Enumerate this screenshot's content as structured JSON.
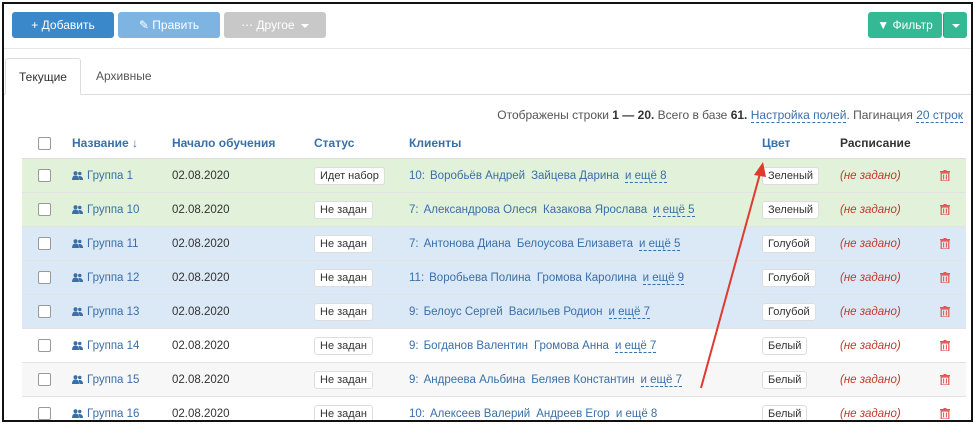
{
  "toolbar": {
    "add_label": "Добавить",
    "edit_label": "Править",
    "other_label": "Другое",
    "filter_label": "Фильтр"
  },
  "tabs": [
    {
      "label": "Текущие",
      "active": true
    },
    {
      "label": "Архивные",
      "active": false
    }
  ],
  "info": {
    "text1": "Отображены строки",
    "range": "1 — 20.",
    "text2": "Всего в базе",
    "total": "61.",
    "settings_link": "Настройка полей",
    "pagination_label": "Пагинация",
    "pagination_value": "20 строк"
  },
  "columns": {
    "name": "Название ↓",
    "start": "Начало обучения",
    "status": "Статус",
    "clients": "Клиенты",
    "color": "Цвет",
    "schedule": "Расписание"
  },
  "rows": [
    {
      "name": "Группа 1",
      "start": "02.08.2020",
      "status": "Идет набор",
      "count": "10:",
      "client1": "Воробьёв Андрей",
      "client2": "Зайцева Дарина",
      "more": "и ещё 8",
      "color": "Зеленый",
      "schedule": "(не задано)",
      "tone": "green"
    },
    {
      "name": "Группа 10",
      "start": "02.08.2020",
      "status": "Не задан",
      "count": "7:",
      "client1": "Александрова Олеся",
      "client2": "Казакова Ярослава",
      "more": "и ещё 5",
      "color": "Зеленый",
      "schedule": "(не задано)",
      "tone": "green"
    },
    {
      "name": "Группа 11",
      "start": "02.08.2020",
      "status": "Не задан",
      "count": "7:",
      "client1": "Антонова Диана",
      "client2": "Белоусова Елизавета",
      "more": "и ещё 5",
      "color": "Голубой",
      "schedule": "(не задано)",
      "tone": "blue"
    },
    {
      "name": "Группа 12",
      "start": "02.08.2020",
      "status": "Не задан",
      "count": "11:",
      "client1": "Воробьева Полина",
      "client2": "Громова Каролина",
      "more": "и ещё 9",
      "color": "Голубой",
      "schedule": "(не задано)",
      "tone": "blue"
    },
    {
      "name": "Группа 13",
      "start": "02.08.2020",
      "status": "Не задан",
      "count": "9:",
      "client1": "Белоус Сергей",
      "client2": "Васильев Родион",
      "more": "и ещё 7",
      "color": "Голубой",
      "schedule": "(не задано)",
      "tone": "blue"
    },
    {
      "name": "Группа 14",
      "start": "02.08.2020",
      "status": "Не задан",
      "count": "9:",
      "client1": "Богданов Валентин",
      "client2": "Громова Анна",
      "more": "и ещё 7",
      "color": "Белый",
      "schedule": "(не задано)",
      "tone": "white"
    },
    {
      "name": "Группа 15",
      "start": "02.08.2020",
      "status": "Не задан",
      "count": "9:",
      "client1": "Андреева Альбина",
      "client2": "Беляев Константин",
      "more": "и ещё 7",
      "color": "Белый",
      "schedule": "(не задано)",
      "tone": "gray"
    },
    {
      "name": "Группа 16",
      "start": "02.08.2020",
      "status": "Не задан",
      "count": "10:",
      "client1": "Алексеев Валерий",
      "client2": "Андреев Егор",
      "more": "и ещё 8",
      "color": "Белый",
      "schedule": "(не задано)",
      "tone": "white"
    }
  ],
  "colors": {
    "accent_blue": "#3a87c9",
    "filter_green": "#35b995",
    "row_green": "#e2f1d9",
    "row_blue": "#dbe9f6",
    "schedule_red": "#c0392b",
    "annotation_arrow": "#e03a2f"
  }
}
